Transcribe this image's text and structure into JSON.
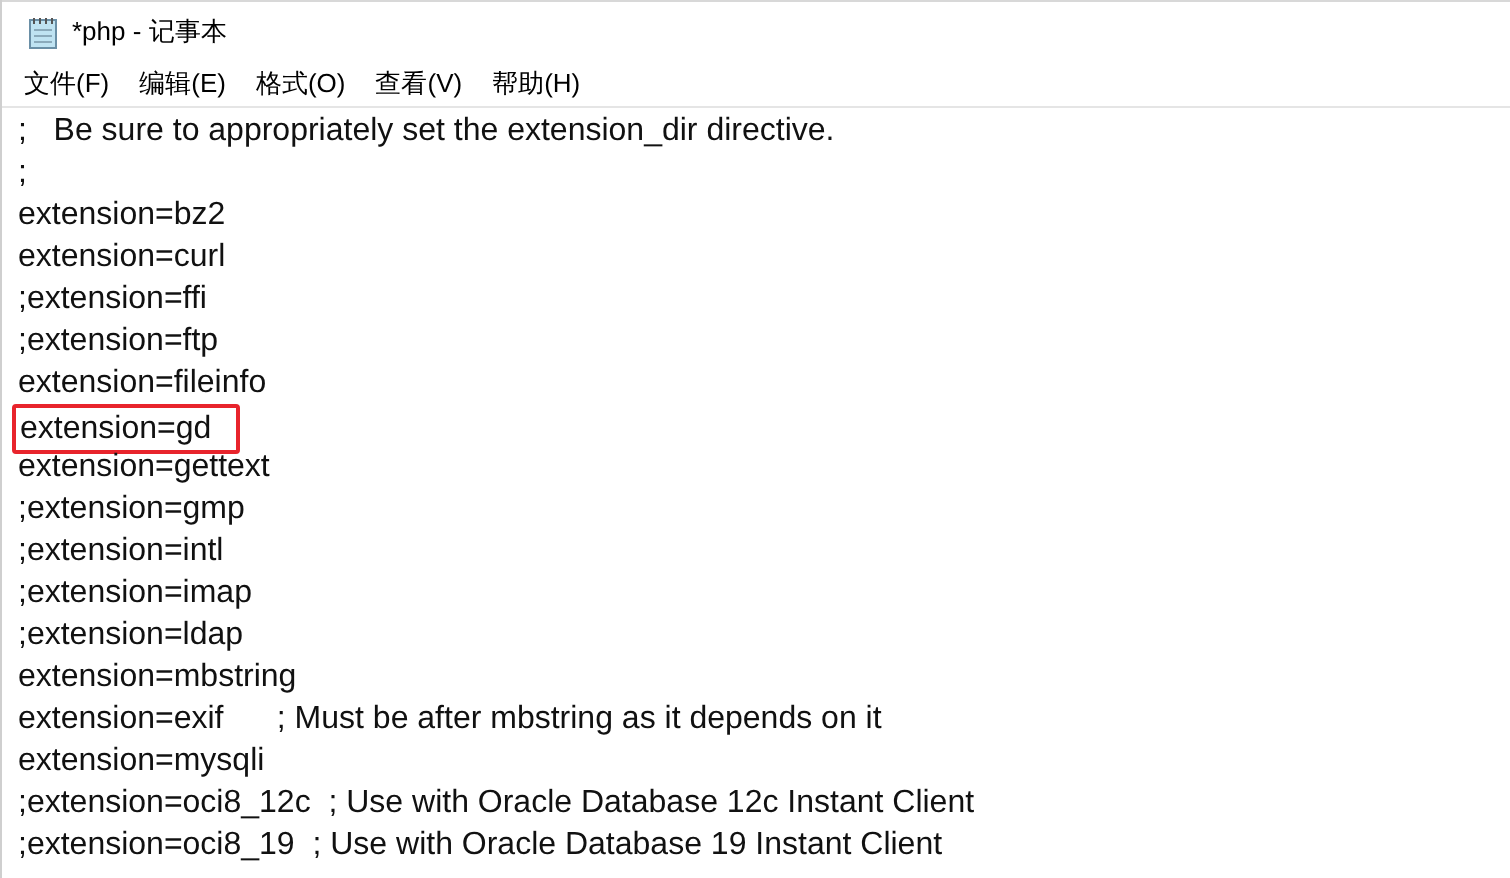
{
  "window": {
    "title": "*php - 记事本"
  },
  "menu": [
    {
      "label": "文件(F)"
    },
    {
      "label": "编辑(E)"
    },
    {
      "label": "格式(O)"
    },
    {
      "label": "查看(V)"
    },
    {
      "label": "帮助(H)"
    }
  ],
  "lines": [
    {
      "text": ";   Be sure to appropriately set the extension_dir directive.",
      "highlighted": false
    },
    {
      "text": ";",
      "highlighted": false
    },
    {
      "text": "extension=bz2",
      "highlighted": false
    },
    {
      "text": "extension=curl",
      "highlighted": false
    },
    {
      "text": ";extension=ffi",
      "highlighted": false
    },
    {
      "text": ";extension=ftp",
      "highlighted": false
    },
    {
      "text": "extension=fileinfo",
      "highlighted": false
    },
    {
      "text": "extension=gd",
      "highlighted": true
    },
    {
      "text": "extension=gettext",
      "highlighted": false
    },
    {
      "text": ";extension=gmp",
      "highlighted": false
    },
    {
      "text": ";extension=intl",
      "highlighted": false
    },
    {
      "text": ";extension=imap",
      "highlighted": false
    },
    {
      "text": ";extension=ldap",
      "highlighted": false
    },
    {
      "text": "extension=mbstring",
      "highlighted": false
    },
    {
      "text": "extension=exif      ; Must be after mbstring as it depends on it",
      "highlighted": false
    },
    {
      "text": "extension=mysqli",
      "highlighted": false
    },
    {
      "text": ";extension=oci8_12c  ; Use with Oracle Database 12c Instant Client",
      "highlighted": false
    },
    {
      "text": ";extension=oci8_19  ; Use with Oracle Database 19 Instant Client",
      "highlighted": false
    }
  ]
}
